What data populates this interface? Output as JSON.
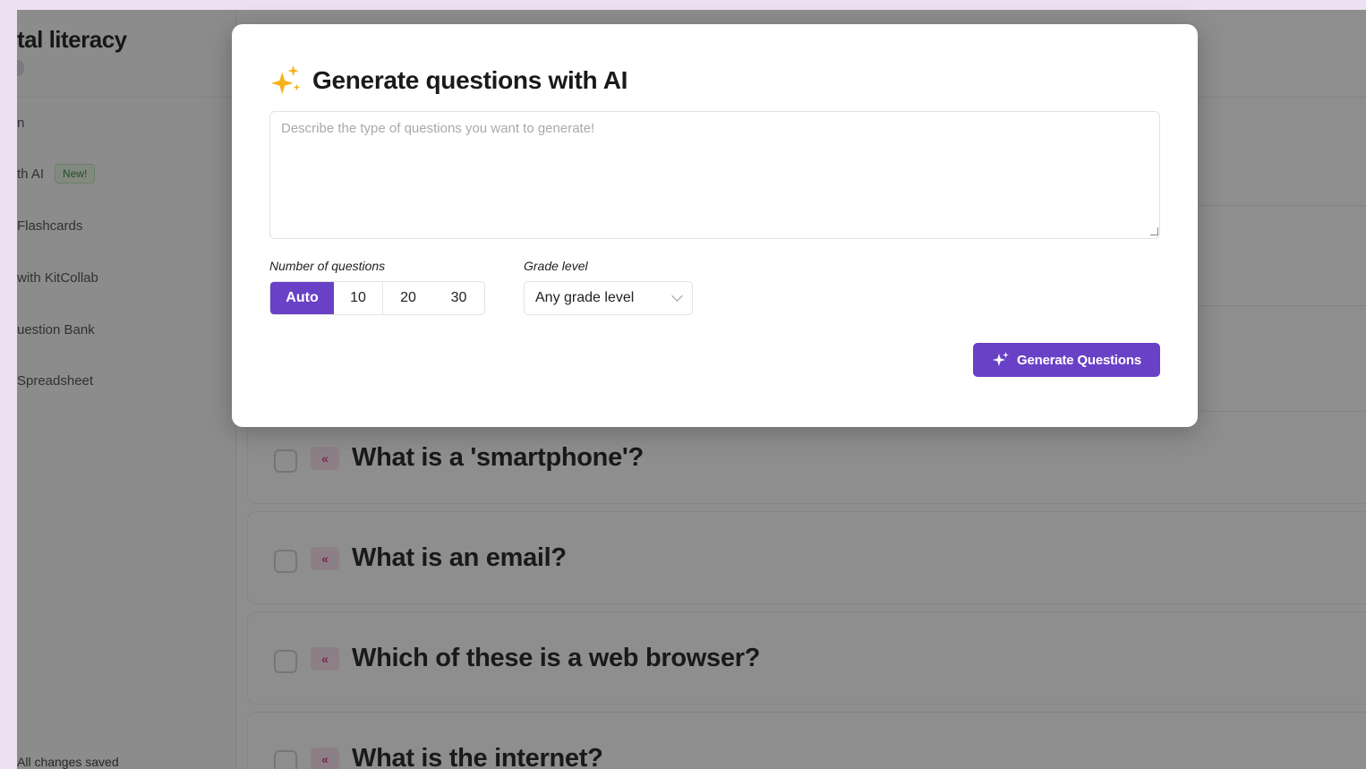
{
  "sidebar": {
    "title": "tal literacy",
    "items": [
      {
        "label": "n"
      },
      {
        "label": "th AI",
        "badge": "New!"
      },
      {
        "label": "Flashcards"
      },
      {
        "label": "with KitCollab"
      },
      {
        "label": "uestion Bank"
      },
      {
        "label": "Spreadsheet"
      }
    ],
    "status": "All changes saved"
  },
  "questions": [
    {
      "type_icon": "multiple-choice-icon",
      "text": "What is a 'smartphone'?"
    },
    {
      "type_icon": "multiple-choice-icon",
      "text": "What is an email?"
    },
    {
      "type_icon": "multiple-choice-icon",
      "text": "Which of these is a web browser?"
    },
    {
      "type_icon": "multiple-choice-icon",
      "text": "What is the internet?"
    }
  ],
  "modal": {
    "title": "Generate questions with AI",
    "prompt_placeholder": "Describe the type of questions you want to generate!",
    "prompt_value": "",
    "count_label": "Number of questions",
    "count_options": [
      "Auto",
      "10",
      "20",
      "30"
    ],
    "count_selected": "Auto",
    "grade_label": "Grade level",
    "grade_value": "Any grade level",
    "generate_label": "Generate Questions"
  },
  "colors": {
    "accent": "#6941c6",
    "background": "#eedff2",
    "new_badge": "#2e7d32",
    "question_type": "#d6336c"
  }
}
